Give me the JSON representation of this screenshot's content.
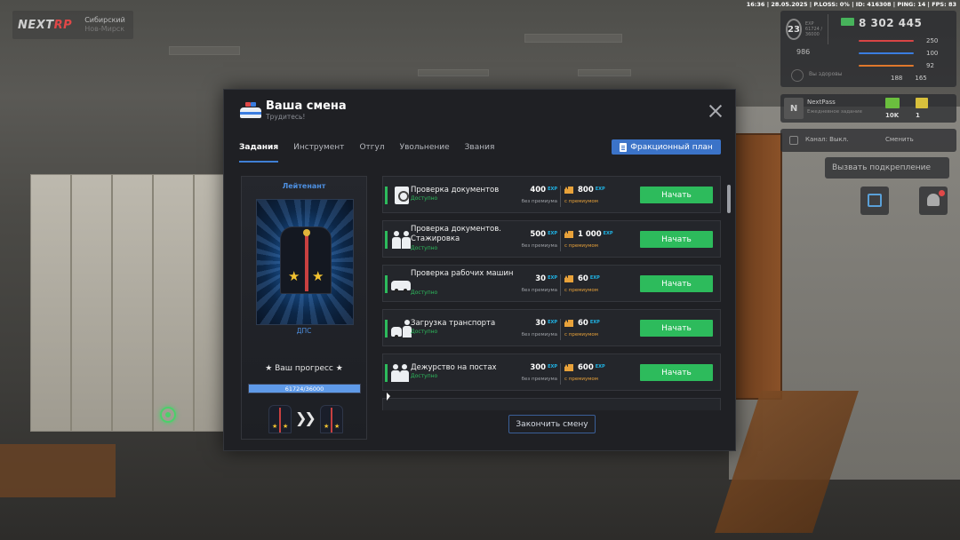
{
  "hud": {
    "logo_main": "NEXT",
    "logo_accent": "RP",
    "server_name": "Сибирский",
    "server_city": "Нов-Мирск",
    "top_info": "16:36 | 28.05.2025 | P.LOSS: 0% | ID: 416308 | PING: 14 | FPS: 83",
    "level": "23",
    "level_sub": "EXP 61724 / 36000",
    "money": "8 302 445",
    "reputation": "986",
    "health_label": "Вы здоровы",
    "stats": [
      {
        "value": "250",
        "color": "#d94545"
      },
      {
        "value": "100",
        "color": "#3a7de0"
      },
      {
        "value": "92",
        "color": "#e0782c"
      },
      {
        "value": "165",
        "color": "#8a8d94"
      }
    ],
    "stat_extra": "188",
    "nextpass_logo": "N",
    "nextpass_title": "NextPass",
    "nextpass_sub": "Ежедневное задание",
    "nextpass_val1": "10K",
    "nextpass_val2": "1",
    "channel_label": "Канал: Выкл.",
    "channel_change": "Сменить",
    "backup_label": "Вызвать подкрепление"
  },
  "modal": {
    "title": "Ваша смена",
    "subtitle": "Трудитесь!",
    "tabs": [
      "Задания",
      "Инструмент",
      "Отгул",
      "Увольнение",
      "Звания"
    ],
    "faction_plan": "Фракционный план",
    "rank": {
      "title": "Лейтенант",
      "department": "ДПС",
      "progress_label": "★ Ваш прогресс ★",
      "progress_text": "61724/36000",
      "progress_fraction": 1.0
    },
    "label_base": "без премиума",
    "label_premium": "с премиумом",
    "exp": "EXP",
    "start": "Начать",
    "end_shift": "Закончить смену",
    "tasks": [
      {
        "name": "Проверка документов",
        "status": "Доступно",
        "base": "400",
        "premium": "800",
        "icon": "document-icon"
      },
      {
        "name": "Проверка документов. Стажировка",
        "status": "Доступно",
        "base": "500",
        "premium": "1 000",
        "icon": "officers-icon"
      },
      {
        "name": "Проверка рабочих машин",
        "status": "Доступно",
        "base": "30",
        "premium": "60",
        "icon": "car-check-icon"
      },
      {
        "name": "Загрузка транспорта",
        "status": "Доступно",
        "base": "30",
        "premium": "60",
        "icon": "tow-icon"
      },
      {
        "name": "Дежурство на постах",
        "status": "Доступно",
        "base": "300",
        "premium": "600",
        "icon": "patrol-icon"
      }
    ]
  }
}
